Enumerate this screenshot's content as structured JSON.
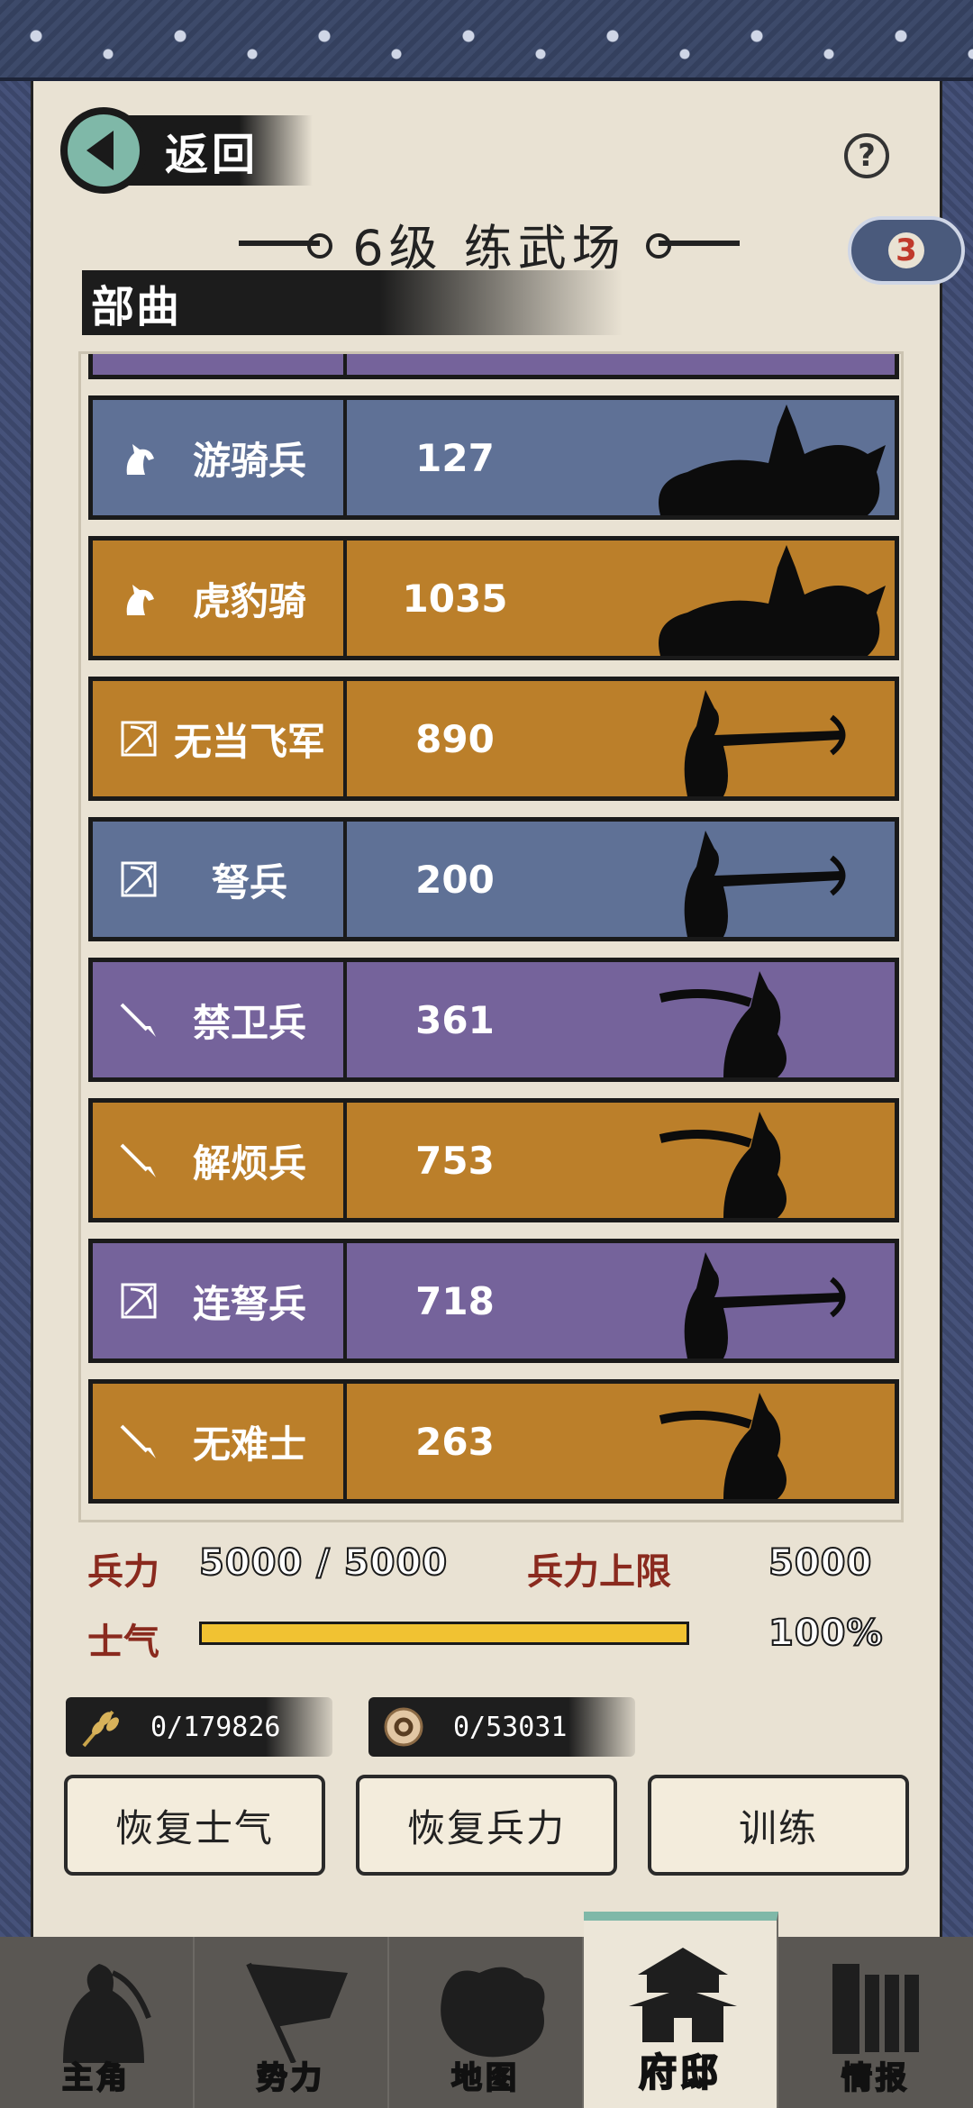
{
  "header": {
    "back_label": "返回",
    "help_symbol": "?",
    "level_title": "6级 练武场",
    "badge_count": "3",
    "section_title": "部曲"
  },
  "troops": [
    {
      "name": "游骑兵",
      "count": "127",
      "color": "#5f7196",
      "icon": "horse-icon"
    },
    {
      "name": "虎豹骑",
      "count": "1035",
      "color": "#bb7f2a",
      "icon": "horse-icon"
    },
    {
      "name": "无当飞军",
      "count": "890",
      "color": "#bb7f2a",
      "icon": "crossbow-icon"
    },
    {
      "name": "弩兵",
      "count": "200",
      "color": "#5f7196",
      "icon": "crossbow-icon"
    },
    {
      "name": "禁卫兵",
      "count": "361",
      "color": "#75639b",
      "icon": "spear-icon"
    },
    {
      "name": "解烦兵",
      "count": "753",
      "color": "#bb7f2a",
      "icon": "spear-icon"
    },
    {
      "name": "连弩兵",
      "count": "718",
      "color": "#75639b",
      "icon": "crossbow-icon"
    },
    {
      "name": "无难士",
      "count": "263",
      "color": "#bb7f2a",
      "icon": "spear-icon"
    }
  ],
  "partial_row_color": "#75639b",
  "stats": {
    "troops_label": "兵力",
    "troops_value": "5000 / 5000",
    "troops_cap_label": "兵力上限",
    "troops_cap_value": "5000",
    "morale_label": "士气",
    "morale_value": "100%",
    "morale_fraction": 1.0
  },
  "resources": {
    "grain": "0/179826",
    "coin": "0/53031"
  },
  "actions": {
    "restore_morale": "恢复士气",
    "restore_troops": "恢复兵力",
    "train": "训练"
  },
  "nav": {
    "hero": "主角",
    "faction": "势力",
    "map": "地图",
    "mansion": "府邸",
    "intel": "情报"
  }
}
